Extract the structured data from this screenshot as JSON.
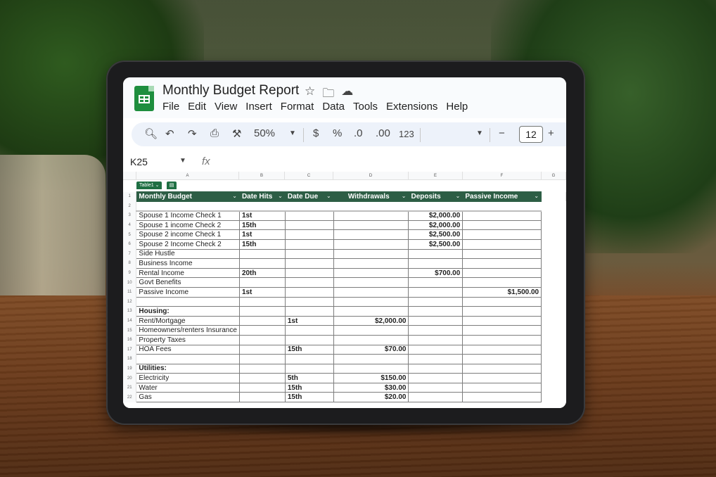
{
  "doc": {
    "title": "Monthly Budget Report",
    "menu": [
      "File",
      "Edit",
      "View",
      "Insert",
      "Format",
      "Data",
      "Tools",
      "Extensions",
      "Help"
    ]
  },
  "toolbar": {
    "zoom": "50%",
    "currency": "$",
    "percent": "%",
    "dec_decrease": ".0",
    "dec_increase": ".00",
    "format_123": "123",
    "font_size": "12",
    "minus": "−",
    "plus": "+"
  },
  "formula_bar": {
    "cell_ref": "K25",
    "fx": "fx",
    "value": ""
  },
  "columns": [
    "A",
    "B",
    "C",
    "D",
    "E",
    "F",
    "G"
  ],
  "table_chip": "Table1",
  "headers": [
    "Monthly Budget",
    "Date Hits",
    "Date Due",
    "Withdrawals",
    "Deposits",
    "Passive Income"
  ],
  "rows": [
    {
      "n": "3",
      "a": "Spouse 1 Income Check 1",
      "b": "1st",
      "c": "",
      "d": "",
      "e": "$2,000.00",
      "f": ""
    },
    {
      "n": "4",
      "a": "Spouse 1 income Check 2",
      "b": "15th",
      "c": "",
      "d": "",
      "e": "$2,000.00",
      "f": ""
    },
    {
      "n": "5",
      "a": "Spouse 2 income Check 1",
      "b": "1st",
      "c": "",
      "d": "",
      "e": "$2,500.00",
      "f": ""
    },
    {
      "n": "6",
      "a": "Spouse 2 Income Check 2",
      "b": "15th",
      "c": "",
      "d": "",
      "e": "$2,500.00",
      "f": ""
    },
    {
      "n": "7",
      "a": "Side Hustle",
      "b": "",
      "c": "",
      "d": "",
      "e": "",
      "f": ""
    },
    {
      "n": "8",
      "a": "Business Income",
      "b": "",
      "c": "",
      "d": "",
      "e": "",
      "f": ""
    },
    {
      "n": "9",
      "a": "Rental Income",
      "b": "20th",
      "c": "",
      "d": "",
      "e": "$700.00",
      "f": ""
    },
    {
      "n": "10",
      "a": "Govt Benefits",
      "b": "",
      "c": "",
      "d": "",
      "e": "",
      "f": ""
    },
    {
      "n": "11",
      "a": "Passive Income",
      "b": "1st",
      "c": "",
      "d": "",
      "e": "",
      "f": "$1,500.00"
    },
    {
      "n": "12",
      "a": "",
      "b": "",
      "c": "",
      "d": "",
      "e": "",
      "f": ""
    },
    {
      "n": "13",
      "a": "Housing:",
      "b": "",
      "c": "",
      "d": "",
      "e": "",
      "f": "",
      "bold": true
    },
    {
      "n": "14",
      "a": "Rent/Mortgage",
      "b": "",
      "c": "1st",
      "d": "$2,000.00",
      "e": "",
      "f": ""
    },
    {
      "n": "15",
      "a": "Homeowners/renters Insurance",
      "b": "",
      "c": "",
      "d": "",
      "e": "",
      "f": ""
    },
    {
      "n": "16",
      "a": "Property Taxes",
      "b": "",
      "c": "",
      "d": "",
      "e": "",
      "f": ""
    },
    {
      "n": "17",
      "a": "HOA Fees",
      "b": "",
      "c": "15th",
      "d": "$70.00",
      "e": "",
      "f": ""
    },
    {
      "n": "18",
      "a": "",
      "b": "",
      "c": "",
      "d": "",
      "e": "",
      "f": ""
    },
    {
      "n": "19",
      "a": "Utilities:",
      "b": "",
      "c": "",
      "d": "",
      "e": "",
      "f": "",
      "bold": true
    },
    {
      "n": "20",
      "a": "Electricity",
      "b": "",
      "c": "5th",
      "d": "$150.00",
      "e": "",
      "f": ""
    },
    {
      "n": "21",
      "a": "Water",
      "b": "",
      "c": "15th",
      "d": "$30.00",
      "e": "",
      "f": ""
    },
    {
      "n": "22",
      "a": "Gas",
      "b": "",
      "c": "15th",
      "d": "$20.00",
      "e": "",
      "f": ""
    }
  ]
}
